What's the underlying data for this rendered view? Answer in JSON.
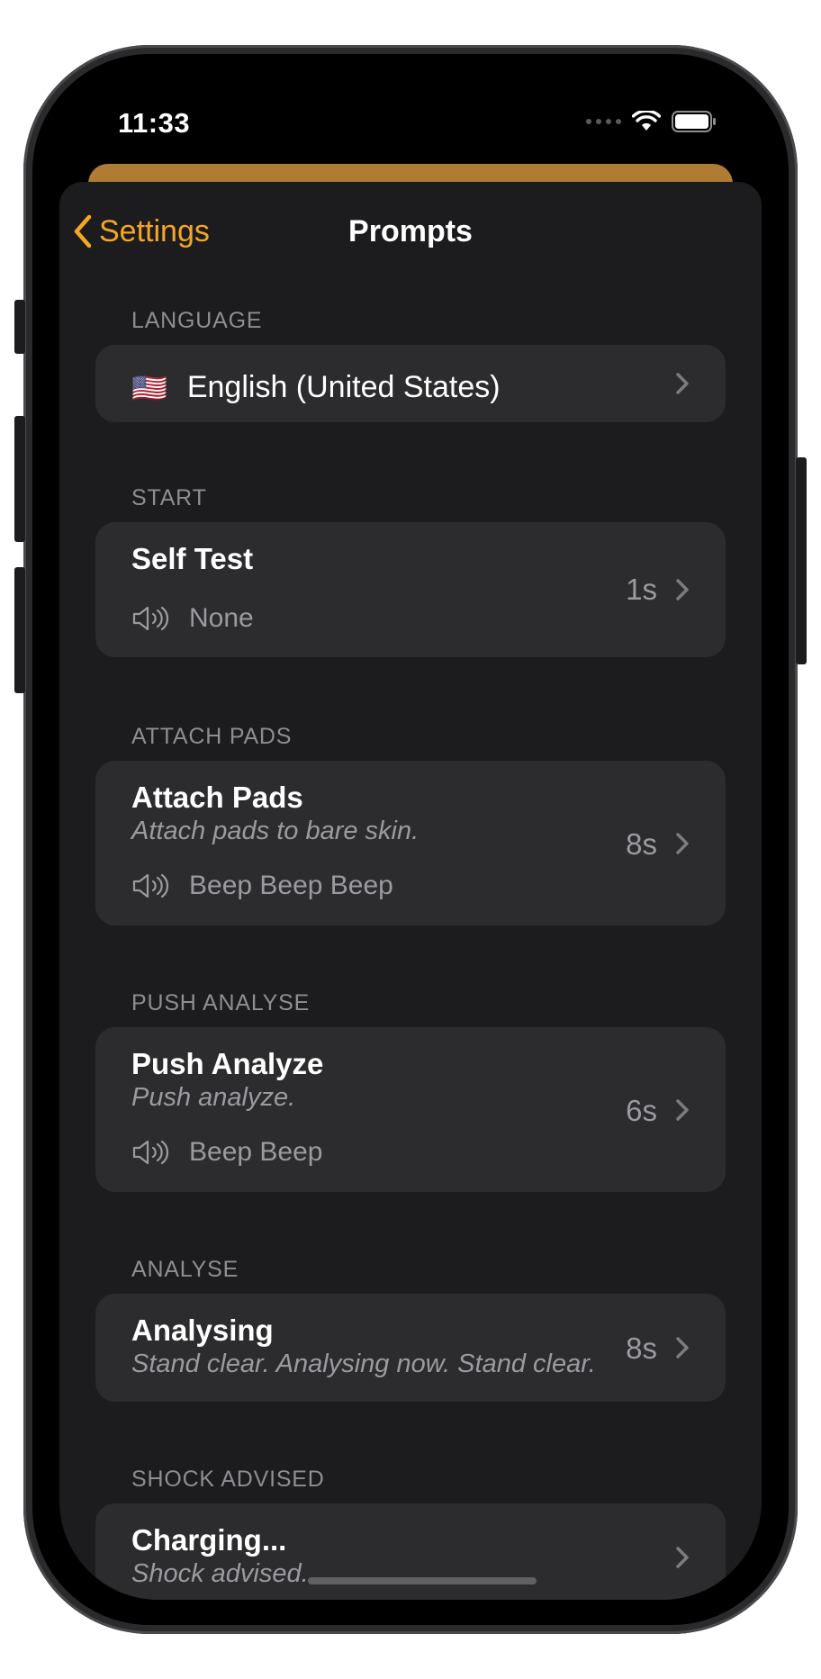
{
  "status_bar": {
    "time": "11:33"
  },
  "nav": {
    "back_label": "Settings",
    "title": "Prompts"
  },
  "colors": {
    "accent": "#f5a623",
    "background": "#1c1c1e",
    "cell": "#2c2c2e",
    "secondary_text": "#9a9aa0",
    "section_header": "#8d8d93"
  },
  "language": {
    "header": "LANGUAGE",
    "flag": "🇺🇸",
    "value": "English (United States)"
  },
  "sections": [
    {
      "header": "START",
      "title": "Self Test",
      "subtitle": "",
      "sound": "None",
      "duration": "1s"
    },
    {
      "header": "ATTACH PADS",
      "title": "Attach Pads",
      "subtitle": "Attach pads to bare skin.",
      "sound": "Beep Beep Beep",
      "duration": "8s"
    },
    {
      "header": "PUSH ANALYSE",
      "title": "Push Analyze",
      "subtitle": "Push analyze.",
      "sound": "Beep Beep",
      "duration": "6s"
    },
    {
      "header": "ANALYSE",
      "title": "Analysing",
      "subtitle": "Stand clear. Analysing now. Stand clear.",
      "sound": "",
      "duration": "8s"
    },
    {
      "header": "SHOCK ADVISED",
      "title": "Charging...",
      "subtitle": "Shock advised.",
      "sound": "",
      "duration": ""
    }
  ]
}
